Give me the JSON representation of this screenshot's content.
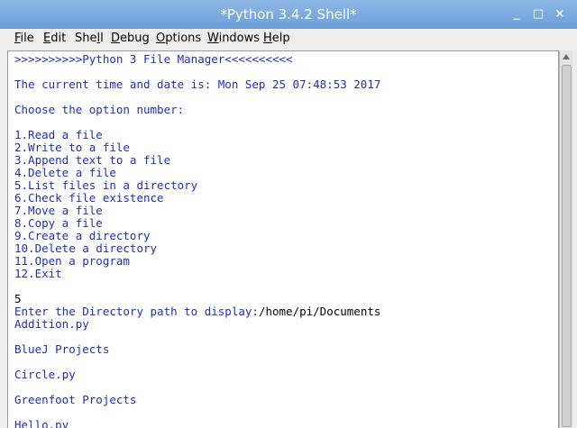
{
  "window": {
    "title": "*Python 3.4.2 Shell*",
    "controls": [
      "_",
      "□",
      "×"
    ]
  },
  "menubar": [
    {
      "accel": "F",
      "rest": "ile"
    },
    {
      "accel": "E",
      "rest": "dit"
    },
    {
      "pre": "She",
      "accel": "l",
      "rest": "l"
    },
    {
      "accel": "D",
      "rest": "ebug"
    },
    {
      "accel": "O",
      "rest": "ptions"
    },
    {
      "accel": "W",
      "rest": "indows"
    },
    {
      "accel": "H",
      "rest": "elp"
    }
  ],
  "shell_lines": [
    {
      "text": ">>>>>>>>>>Python 3 File Manager<<<<<<<<<<",
      "kind": "out"
    },
    {
      "text": "",
      "kind": "out"
    },
    {
      "text": "The current time and date is: Mon Sep 25 07:48:53 2017",
      "kind": "out"
    },
    {
      "text": "",
      "kind": "out"
    },
    {
      "text": "Choose the option number:",
      "kind": "out"
    },
    {
      "text": "",
      "kind": "out"
    },
    {
      "text": "1.Read a file",
      "kind": "out"
    },
    {
      "text": "2.Write to a file",
      "kind": "out"
    },
    {
      "text": "3.Append text to a file",
      "kind": "out"
    },
    {
      "text": "4.Delete a file",
      "kind": "out"
    },
    {
      "text": "5.List files in a directory",
      "kind": "out"
    },
    {
      "text": "6.Check file existence",
      "kind": "out"
    },
    {
      "text": "7.Move a file",
      "kind": "out"
    },
    {
      "text": "8.Copy a file",
      "kind": "out"
    },
    {
      "text": "9.Create a directory",
      "kind": "out"
    },
    {
      "text": "10.Delete a directory",
      "kind": "out"
    },
    {
      "text": "11.Open a program",
      "kind": "out"
    },
    {
      "text": "12.Exit",
      "kind": "out"
    },
    {
      "text": "",
      "kind": "out"
    },
    {
      "text": "5",
      "kind": "inp"
    },
    {
      "text": "Enter the Directory path to display:",
      "kind": "out",
      "input": "/home/pi/Documents"
    },
    {
      "text": "Addition.py",
      "kind": "out"
    },
    {
      "text": "",
      "kind": "out"
    },
    {
      "text": "BlueJ Projects",
      "kind": "out"
    },
    {
      "text": "",
      "kind": "out"
    },
    {
      "text": "Circle.py",
      "kind": "out"
    },
    {
      "text": "",
      "kind": "out"
    },
    {
      "text": "Greenfoot Projects",
      "kind": "out"
    },
    {
      "text": "",
      "kind": "out"
    },
    {
      "text": "Hello.py",
      "kind": "out"
    }
  ],
  "colors": {
    "titlebar": "#7aa8de",
    "output_text": "#1d2fc4",
    "input_text": "#000000"
  }
}
